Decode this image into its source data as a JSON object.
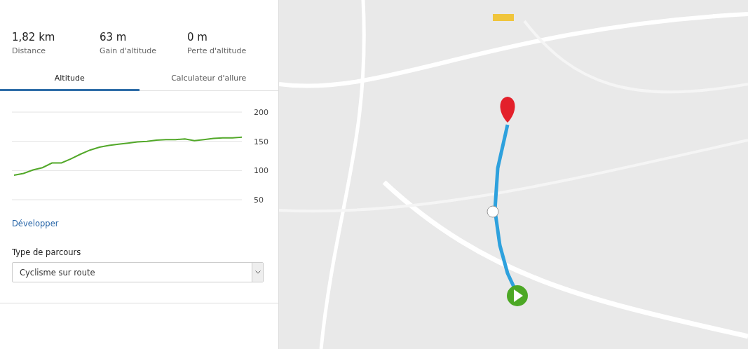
{
  "stats": [
    {
      "value": "1,82 km",
      "label": "Distance"
    },
    {
      "value": "63 m",
      "label": "Gain d'altitude"
    },
    {
      "value": "0 m",
      "label": "Perte d'altitude"
    }
  ],
  "tabs": [
    {
      "label": "Altitude",
      "selected": true
    },
    {
      "label": "Calculateur d'allure",
      "selected": false
    }
  ],
  "chart_data": {
    "type": "line",
    "grid": true,
    "ylim": [
      50,
      200
    ],
    "yticks": [
      50,
      100,
      150,
      200
    ],
    "series": [
      {
        "color": "#52a829",
        "values": [
          92,
          95,
          101,
          105,
          113,
          113,
          120,
          128,
          135,
          140,
          143,
          145,
          147,
          149,
          150,
          152,
          153,
          153,
          154,
          151,
          153,
          155,
          156,
          156,
          157
        ]
      }
    ]
  },
  "expand_link": "Développer",
  "route_type": {
    "label": "Type de parcours",
    "value": "Cyclisme sur route"
  }
}
